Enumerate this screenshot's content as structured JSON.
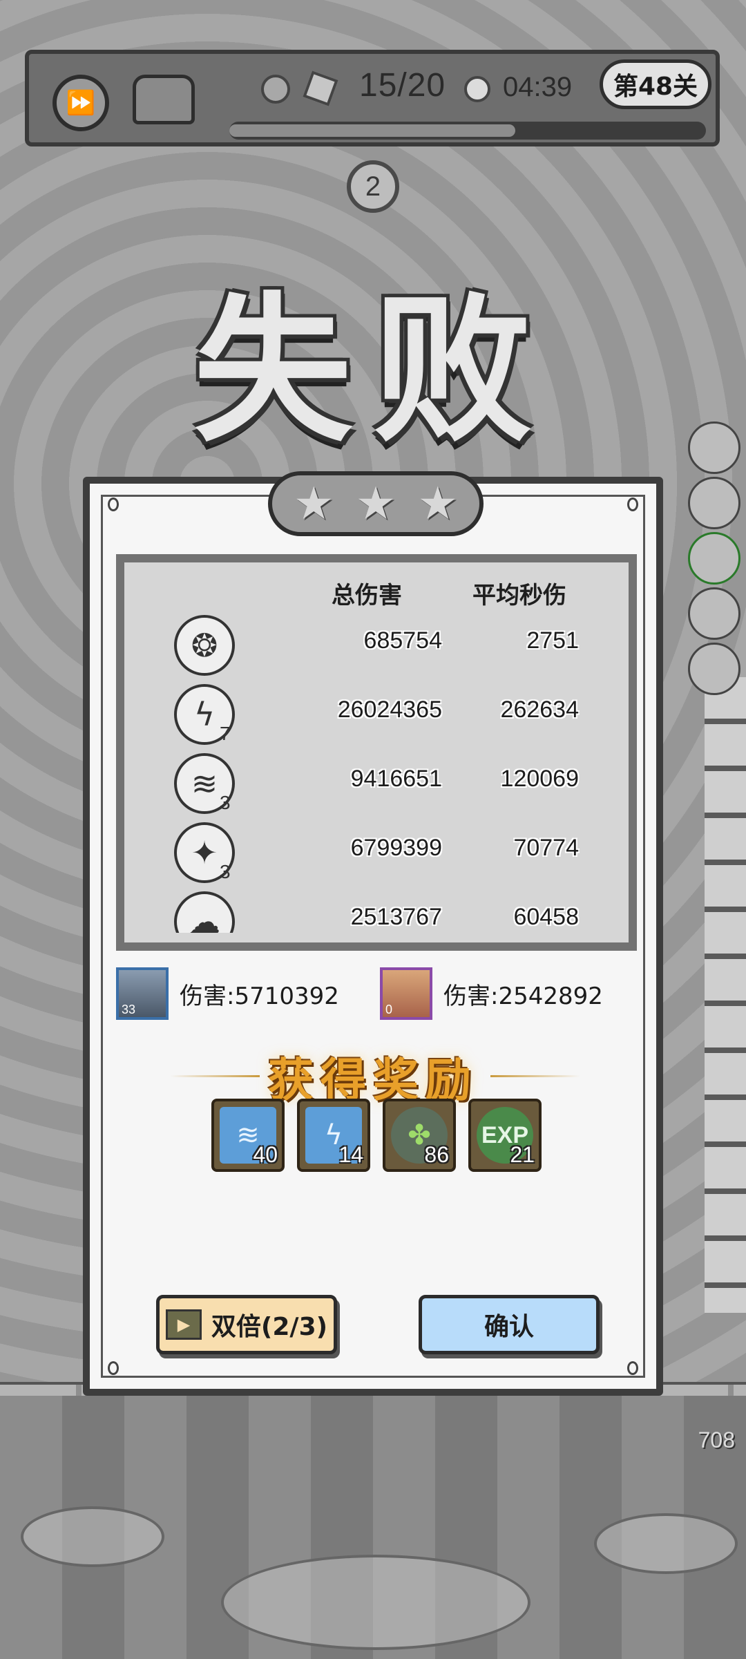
{
  "hud": {
    "wave_text": "15/20",
    "time_text": "04:39",
    "level_label": "第48关",
    "progress_fraction": 0.6,
    "wave_counter": "2"
  },
  "defeat_title": "失败",
  "stars": [
    "★",
    "★",
    "★"
  ],
  "stats": {
    "header_total": "总伤害",
    "header_dps": "平均秒伤",
    "rows": [
      {
        "icon": "seed-skill-icon",
        "level": "",
        "total": "685754",
        "dps": "2751"
      },
      {
        "icon": "lightning-skill-icon",
        "level": "7",
        "total": "26024365",
        "dps": "262634"
      },
      {
        "icon": "tornado-skill-icon",
        "level": "3",
        "total": "9416651",
        "dps": "120069"
      },
      {
        "icon": "crystal-skill-icon",
        "level": "3",
        "total": "6799399",
        "dps": "70774"
      },
      {
        "icon": "storm-skill-icon",
        "level": "",
        "total": "2513767",
        "dps": "60458"
      }
    ]
  },
  "heroes": [
    {
      "level": "33",
      "damage": "伤害:5710392"
    },
    {
      "level": "0",
      "damage": "伤害:2542892"
    }
  ],
  "rewards": {
    "title": "获得奖励",
    "items": [
      {
        "icon": "tornado-card-icon",
        "count": "40"
      },
      {
        "icon": "lightning-card-icon",
        "count": "14"
      },
      {
        "icon": "herb-icon",
        "count": "86"
      },
      {
        "icon": "exp-icon",
        "label": "EXP",
        "count": "21"
      }
    ]
  },
  "buttons": {
    "double_label": "双倍(2/3)",
    "confirm_label": "确认"
  },
  "bottom_number": "708"
}
